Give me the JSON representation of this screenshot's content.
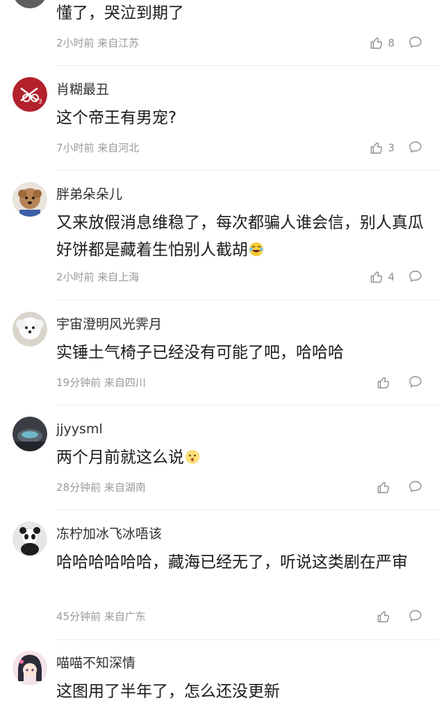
{
  "comments": [
    {
      "username": "",
      "content": "懂了，哭泣到期了",
      "meta": "2小时前 来自江苏",
      "likes": "8",
      "avatar_icon": "avatar-partial-icon"
    },
    {
      "username": "肖糊最丑",
      "content": "这个帝王有男宠?",
      "meta": "7小时前 来自河北",
      "likes": "3",
      "avatar_icon": "avatar-red-logo-icon"
    },
    {
      "username": "胖弟朵朵儿",
      "content": "又来放假消息维稳了，每次都骗人谁会信，别人真瓜好饼都是藏着生怕别人截胡",
      "emoji": "laughing-tears-emoji",
      "meta": "2小时前 来自上海",
      "likes": "4",
      "avatar_icon": "avatar-poodle-icon"
    },
    {
      "username": "宇宙澄明风光霁月",
      "content": "实锤土气椅子已经没有可能了吧，哈哈哈",
      "meta": "19分钟前 来自四川",
      "likes": "",
      "avatar_icon": "avatar-white-dog-icon"
    },
    {
      "username": "jjyysml",
      "content": "两个月前就这么说",
      "emoji": "shocked-emoji",
      "meta": "28分钟前 来自湖南",
      "likes": "",
      "avatar_icon": "avatar-dark-photo-icon"
    },
    {
      "username": "冻柠加冰飞冰唔该",
      "content": "哈哈哈哈哈哈，藏海已经无了，听说这类剧在严审",
      "meta": "45分钟前 来自广东",
      "likes": "",
      "avatar_icon": "avatar-panda-icon"
    },
    {
      "username": "喵喵不知深情",
      "content": "这图用了半年了，怎么还没更新",
      "meta": "",
      "likes": "",
      "avatar_icon": "avatar-anime-girl-icon"
    }
  ],
  "colors": {
    "text_primary": "#1b1b1b",
    "text_meta": "#9a9a9a",
    "icon_gray": "#8e8e8e",
    "divider": "#ececec",
    "avatar_red": "#b3212c"
  }
}
